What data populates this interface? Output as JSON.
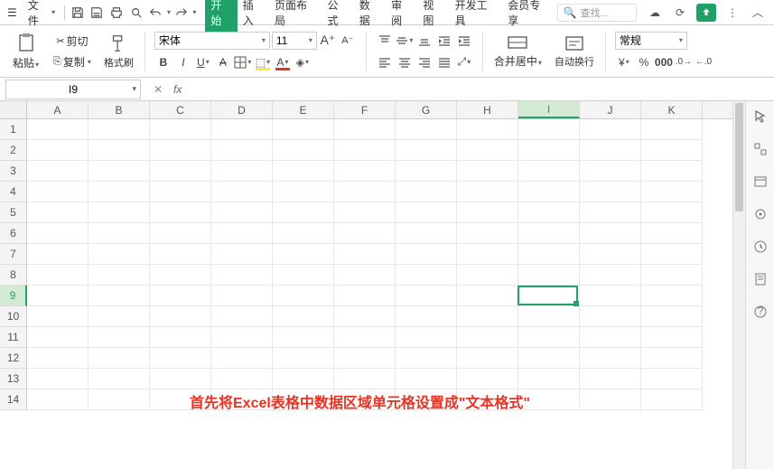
{
  "menu": {
    "file": "文件"
  },
  "tabs": [
    "开始",
    "插入",
    "页面布局",
    "公式",
    "数据",
    "审阅",
    "视图",
    "开发工具",
    "会员专享"
  ],
  "activeTab": 0,
  "search": {
    "placeholder": "查找..."
  },
  "ribbon": {
    "paste": "粘贴",
    "cut": "剪切",
    "copy": "复制",
    "format_painter": "格式刷",
    "font": "宋体",
    "size": "11",
    "merge": "合并居中",
    "wrap": "自动换行",
    "number_format": "常规"
  },
  "namebox": "I9",
  "columns": [
    "A",
    "B",
    "C",
    "D",
    "E",
    "F",
    "G",
    "H",
    "I",
    "J",
    "K"
  ],
  "activeCol": "I",
  "rows": [
    1,
    2,
    3,
    4,
    5,
    6,
    7,
    8,
    9,
    10,
    11,
    12,
    13,
    14
  ],
  "activeRow": 9,
  "overlay": "首先将Excel表格中数据区域单元格设置成\"文本格式\""
}
